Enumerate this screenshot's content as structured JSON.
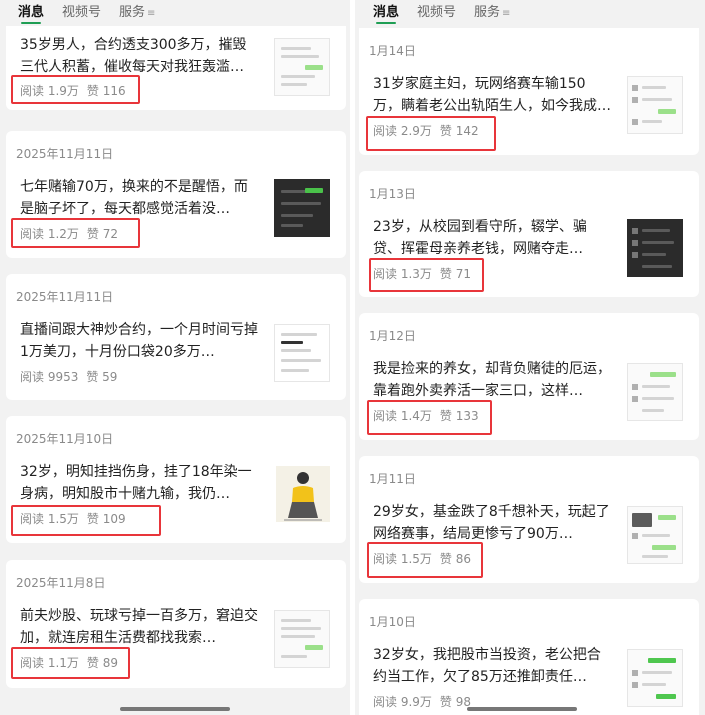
{
  "left": {
    "tabs": [
      {
        "label": "消息",
        "active": true
      },
      {
        "label": "视频号",
        "active": false
      },
      {
        "label": "服务",
        "active": false
      }
    ],
    "cards": [
      {
        "date": "",
        "title": "35岁男人，合约透支300多万，摧毁三代人积蓄，催收每天对我狂轰滥…",
        "reads": "阅读 1.9万",
        "likes": "赞 116"
      },
      {
        "date": "2025年11月11日",
        "title": "七年赌输70万，换来的不是醒悟，而是脑子坏了，每天都感觉活着没…",
        "reads": "阅读 1.2万",
        "likes": "赞 72"
      },
      {
        "date": "2025年11月11日",
        "title": "直播间跟大神炒合约，一个月时间亏掉1万美刀，十月份口袋20多万…",
        "reads": "阅读 9953",
        "likes": "赞 59"
      },
      {
        "date": "2025年11月10日",
        "title": "32岁，明知挂挡伤身，挂了18年染一身病，明知股市十赌九输，我仍…",
        "reads": "阅读 1.5万",
        "likes": "赞 109"
      },
      {
        "date": "2025年11月8日",
        "title": "前夫炒股、玩球亏掉一百多万，窘迫交加，就连房租生活费都找我索…",
        "reads": "阅读 1.1万",
        "likes": "赞 89"
      }
    ]
  },
  "right": {
    "tabs": [
      {
        "label": "消息",
        "active": true
      },
      {
        "label": "视频号",
        "active": false
      },
      {
        "label": "服务",
        "active": false
      }
    ],
    "cards": [
      {
        "date": "1月14日",
        "title": "31岁家庭主妇，玩网络赛车输150万，瞒着老公出轨陌生人，如今我成…",
        "reads": "阅读 2.9万",
        "likes": "赞 142"
      },
      {
        "date": "1月13日",
        "title": "23岁，从校园到看守所，辍学、骗贷、挥霍母亲养老钱，网赌夺走…",
        "reads": "阅读 1.3万",
        "likes": "赞 71"
      },
      {
        "date": "1月12日",
        "title": "我是捡来的养女，却背负赌徒的厄运，靠着跑外卖养活一家三口，这样…",
        "reads": "阅读 1.4万",
        "likes": "赞 133"
      },
      {
        "date": "1月11日",
        "title": "29岁女，基金跌了8千想补天，玩起了网络赛事，结局更惨亏了90万…",
        "reads": "阅读 1.5万",
        "likes": "赞 86"
      },
      {
        "date": "1月10日",
        "title": "32岁女，我把股市当投资，老公把合约当工作，欠了85万还推卸责任…",
        "reads": "阅读 9.9万",
        "likes": "赞 98"
      }
    ]
  },
  "colors": {
    "highlight": "#e8353a",
    "active_tab_underline": "#1f9e54",
    "card_bg": "#ffffff",
    "page_bg": "#f2f2f2"
  },
  "icons": {
    "tab_menu": "menu-lines-icon"
  }
}
